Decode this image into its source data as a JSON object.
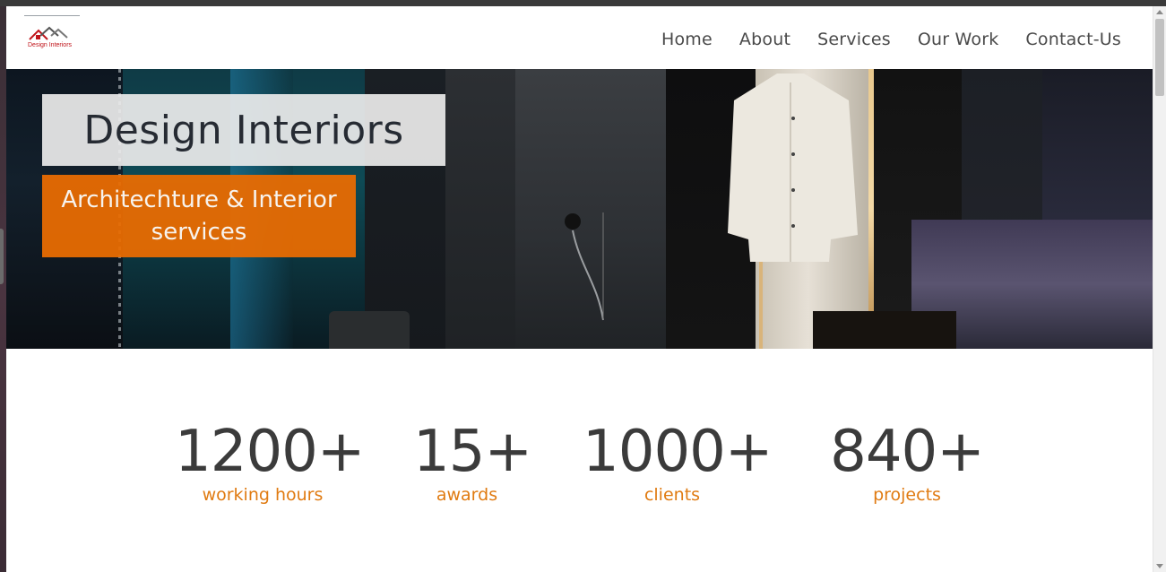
{
  "logo": {
    "text": "Design Interiors",
    "accent": "#c0141a"
  },
  "nav": {
    "items": [
      "Home",
      "About",
      "Services",
      "Our Work",
      "Contact-Us"
    ]
  },
  "hero": {
    "title": "Design Interiors",
    "subtitle": "Architechture & Interior services",
    "accent": "#e86c02"
  },
  "stats": [
    {
      "value": "1200+",
      "label": "working hours"
    },
    {
      "value": "15+",
      "label": "awards"
    },
    {
      "value": "1000+",
      "label": "clients"
    },
    {
      "value": "840+",
      "label": "projects"
    }
  ]
}
